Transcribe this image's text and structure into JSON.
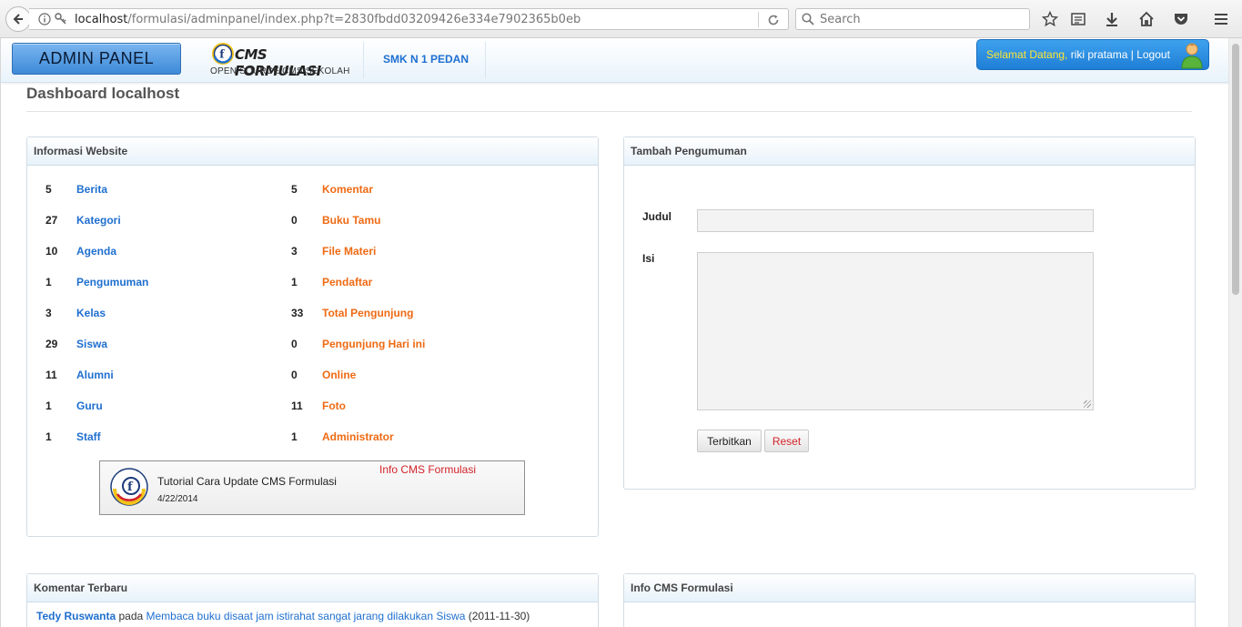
{
  "browser": {
    "url_host": "localhost",
    "url_path": "/formulasi/adminpanel/index.php?t=2830fbdd03209426e334e7902365b0eb",
    "search_placeholder": "Search"
  },
  "nav": {
    "admin_button": "ADMIN PANEL",
    "logo_title": "CMS FORMULASI",
    "logo_subtitle": "OPEN SOURCE CMS SEKOLAH",
    "school_link": "SMK N 1 PEDAN",
    "welcome_greeting": "Selamat Datang,",
    "welcome_user": " riki pratama | ",
    "logout_label": "Logout"
  },
  "dashboard": {
    "title": "Dashboard localhost"
  },
  "info_panel": {
    "title": "Informasi Website",
    "left_stats": [
      {
        "count": "5",
        "label": "Berita"
      },
      {
        "count": "27",
        "label": "Kategori"
      },
      {
        "count": "10",
        "label": "Agenda"
      },
      {
        "count": "1",
        "label": "Pengumuman"
      },
      {
        "count": "3",
        "label": "Kelas"
      },
      {
        "count": "29",
        "label": "Siswa"
      },
      {
        "count": "11",
        "label": "Alumni"
      },
      {
        "count": "1",
        "label": "Guru"
      },
      {
        "count": "1",
        "label": "Staff"
      }
    ],
    "right_stats": [
      {
        "count": "5",
        "label": "Komentar"
      },
      {
        "count": "0",
        "label": "Buku Tamu"
      },
      {
        "count": "3",
        "label": "File Materi"
      },
      {
        "count": "1",
        "label": "Pendaftar"
      },
      {
        "count": "33",
        "label": "Total Pengunjung"
      },
      {
        "count": "0",
        "label": "Pengunjung Hari ini"
      },
      {
        "count": "0",
        "label": "Online"
      },
      {
        "count": "11",
        "label": "Foto"
      },
      {
        "count": "1",
        "label": "Administrator"
      }
    ],
    "news_widget": {
      "header": "Info CMS Formulasi",
      "title": "Tutorial Cara Update CMS Formulasi",
      "date": "4/22/2014"
    }
  },
  "announce_panel": {
    "title": "Tambah Pengumuman",
    "judul_label": "Judul",
    "isi_label": "Isi",
    "judul_value": "",
    "isi_value": "",
    "publish_button": "Terbitkan",
    "reset_button": "Reset"
  },
  "comments_panel": {
    "title": "Komentar Terbaru",
    "author": "Tedy Ruswanta",
    "connector": " pada ",
    "post_title": "Membaca buku disaat jam istirahat sangat jarang dilakukan Siswa",
    "date": " (2011-11-30)"
  },
  "info_cms_panel": {
    "title": "Info CMS Formulasi"
  },
  "colors": {
    "link_blue": "#1f6fcf",
    "link_orange": "#ee6a13",
    "admin_button": "#3d8ad8",
    "welcome_box": "#1f7ed6",
    "welcome_highlight": "#ffe632",
    "reset_text": "#d2232a"
  }
}
